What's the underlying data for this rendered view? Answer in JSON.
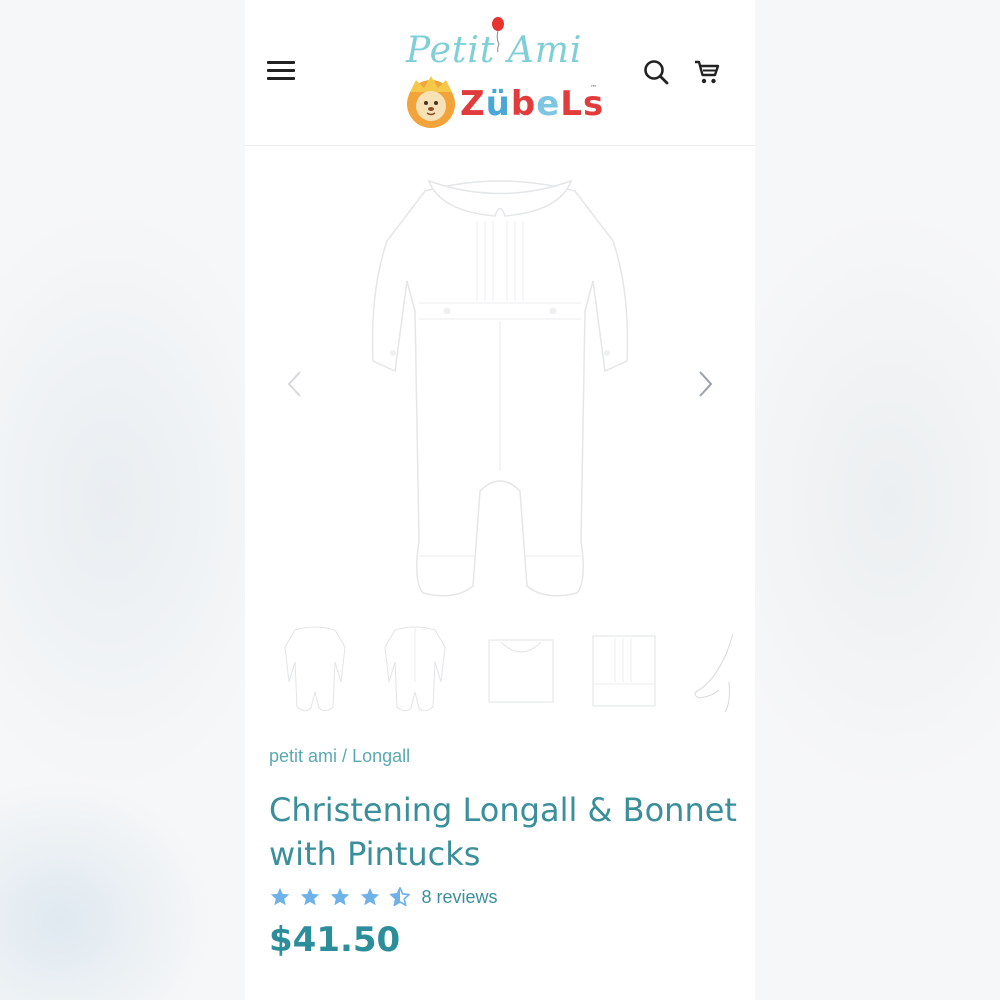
{
  "header": {
    "logo_top": "Petit Ami",
    "logo_bottom_parts": [
      "Z",
      "ü",
      "b",
      "e",
      "L",
      "s"
    ],
    "logo_tm": "™",
    "menu_icon": "hamburger-icon",
    "search_icon": "search-icon",
    "cart_icon": "cart-icon"
  },
  "gallery": {
    "prev_icon": "chevron-left-icon",
    "next_icon": "chevron-right-icon",
    "thumbnail_count": 5
  },
  "breadcrumb": {
    "brand": "petit ami",
    "separator": "/",
    "category": "Longall"
  },
  "product": {
    "title": "Christening Longall & Bonnet with Pintucks",
    "rating": 4.5,
    "reviews_label": "8 reviews",
    "price": "$41.50"
  },
  "colors": {
    "accent": "#3a8f9a",
    "price": "#2c8e9b",
    "star": "#6fb2ea",
    "breadcrumb": "#5aa9b0"
  }
}
